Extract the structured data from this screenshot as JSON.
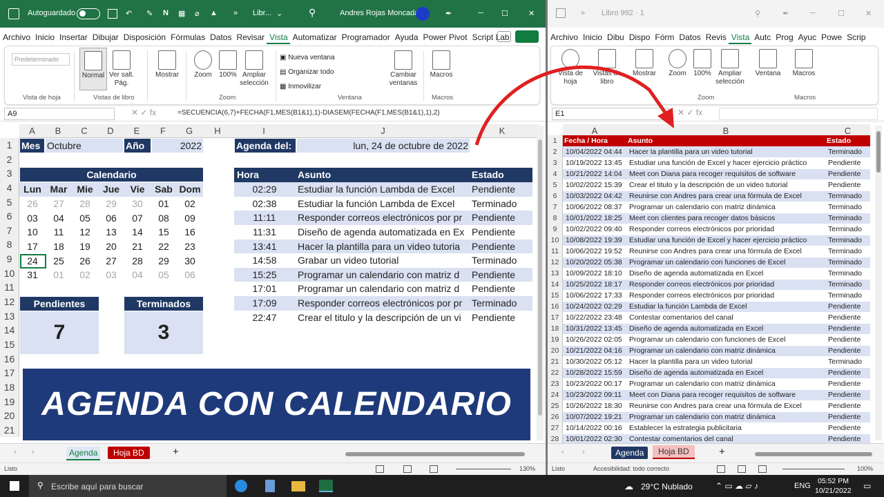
{
  "left": {
    "titlebar": {
      "autosave": "Autoguardado",
      "doc": "Libr...",
      "user": "Andres Rojas Moncada",
      "avatar": "excel"
    },
    "tabs": [
      "Archivo",
      "Inicio",
      "Insertar",
      "Dibujar",
      "Disposición",
      "Fórmulas",
      "Datos",
      "Revisar",
      "Vista",
      "Automatizar",
      "Programador",
      "Ayuda",
      "Power Pivot",
      "Script Lab"
    ],
    "active_tab": "Vista",
    "ribbon": {
      "default_view": "Predeterminado",
      "normal": "Normal",
      "page_break": "Ver salt. Pág.",
      "show": "Mostrar",
      "zoom": "Zoom",
      "zoom100": "100%",
      "zoom_sel": "Ampliar selección",
      "new_window": "Nueva ventana",
      "arrange": "Organizar todo",
      "freeze": "Inmovilizar",
      "switch": "Cambiar ventanas",
      "macros": "Macros",
      "groups": {
        "sheet_view": "Vista de hoja",
        "book_views": "Vistas de libro",
        "zoom": "Zoom",
        "window": "Ventana",
        "macros": "Macros"
      }
    },
    "namebox": "A9",
    "formula": "=SECUENCIA(6,7)+FECHA(F1,MES(B1&1),1)-DIASEM(FECHA(F1,MES(B1&1),1),2)",
    "columns": [
      "A",
      "B",
      "C",
      "D",
      "E",
      "F",
      "G",
      "H",
      "I",
      "J",
      "K"
    ],
    "rows": [
      "1",
      "2",
      "3",
      "4",
      "5",
      "6",
      "7",
      "8",
      "9",
      "10",
      "11",
      "12",
      "13",
      "14",
      "15",
      "16",
      "17",
      "18",
      "19",
      "20",
      "21"
    ],
    "mes_label": "Mes",
    "mes_value": "Octubre",
    "anio_label": "Año",
    "anio_value": "2022",
    "calendar_title": "Calendario",
    "weekdays": [
      "Lun",
      "Mar",
      "Mie",
      "Jue",
      "Vie",
      "Sab",
      "Dom"
    ],
    "weeks": [
      [
        "26",
        "27",
        "28",
        "29",
        "30",
        "01",
        "02"
      ],
      [
        "03",
        "04",
        "05",
        "06",
        "07",
        "08",
        "09"
      ],
      [
        "10",
        "11",
        "12",
        "13",
        "14",
        "15",
        "16"
      ],
      [
        "17",
        "18",
        "19",
        "20",
        "21",
        "22",
        "23"
      ],
      [
        "24",
        "25",
        "26",
        "27",
        "28",
        "29",
        "30"
      ],
      [
        "31",
        "01",
        "02",
        "03",
        "04",
        "05",
        "06"
      ]
    ],
    "pend_label": "Pendientes",
    "pend_value": "7",
    "term_label": "Terminados",
    "term_value": "3",
    "agenda_label": "Agenda del:",
    "agenda_date": "lun, 24 de octubre de 2022",
    "agenda_headers": [
      "Hora",
      "Asunto",
      "Estado"
    ],
    "agenda": [
      [
        "02:29",
        "Estudiar la función Lambda de Excel",
        "Pendiente"
      ],
      [
        "02:38",
        "Estudiar la función Lambda de Excel",
        "Terminado"
      ],
      [
        "11:11",
        "Responder correos electrónicos por pr",
        "Pendiente"
      ],
      [
        "11:31",
        "Diseño de agenda automatizada en Ex",
        "Pendiente"
      ],
      [
        "13:41",
        "Hacer la plantilla para un video tutoria",
        "Pendiente"
      ],
      [
        "14:58",
        "Grabar un video tutorial",
        "Terminado"
      ],
      [
        "15:25",
        "Programar un calendario con matriz d",
        "Pendiente"
      ],
      [
        "17:01",
        "Programar un calendario con matriz d",
        "Pendiente"
      ],
      [
        "17:09",
        "Responder correos electrónicos por pr",
        "Terminado"
      ],
      [
        "22:47",
        "Crear el titulo y la descripción de un vi",
        "Pendiente"
      ]
    ],
    "banner": "AGENDA CON CALENDARIO",
    "sheets": [
      "Agenda",
      "Hoja BD"
    ],
    "status": "Listo",
    "zoom": "130%"
  },
  "right": {
    "titlebar": {
      "doc": "Libro 992 · 1"
    },
    "tabs": [
      "Archivo",
      "Inicio",
      "Dibu",
      "Dispo",
      "Fórm",
      "Datos",
      "Revis",
      "Vista",
      "Autc",
      "Prog",
      "Ayuc",
      "Powe",
      "Scrip"
    ],
    "active_tab": "Vista",
    "ribbon": {
      "sheet_view": "Vista de hoja",
      "book_views": "Vistas de libro",
      "show": "Mostrar",
      "zoom": "Zoom",
      "zoom100": "100%",
      "zoom_sel": "Ampliar selección",
      "window": "Ventana",
      "macros": "Macros",
      "groups": {
        "zoom": "Zoom",
        "macros": "Macros"
      }
    },
    "namebox": "E1",
    "columns": [
      "A",
      "B",
      "C"
    ],
    "headers": [
      "Fecha / Hora",
      "Asunto",
      "Estado"
    ],
    "rows": [
      [
        "10/04/2022 04:44",
        "Hacer la plantilla para un video tutorial",
        "Terminado"
      ],
      [
        "10/19/2022 13:45",
        "Estudiar una función de Excel y hacer ejercicio práctico",
        "Pendiente"
      ],
      [
        "10/21/2022 14:04",
        "Meet con Diana para recoger requisitos de software",
        "Pendiente"
      ],
      [
        "10/02/2022 15:39",
        "Crear el titulo y la descripción de un video tutorial",
        "Pendiente"
      ],
      [
        "10/03/2022 04:42",
        "Reunirse con Andres para crear una fórmula de Excel",
        "Terminado"
      ],
      [
        "10/06/2022 08:37",
        "Programar un calendario con matriz dinámica",
        "Terminado"
      ],
      [
        "10/01/2022 18:25",
        "Meet con clientes para recoger datos básicos",
        "Terminado"
      ],
      [
        "10/02/2022 09:40",
        "Responder correos electrónicos por prioridad",
        "Terminado"
      ],
      [
        "10/08/2022 19:39",
        "Estudiar una función de Excel y hacer ejercicio práctico",
        "Terminado"
      ],
      [
        "10/06/2022 19:52",
        "Reunirse con Andres para crear una fórmula de Excel",
        "Terminado"
      ],
      [
        "10/20/2022 05:38",
        "Programar un calendario con funciones de Excel",
        "Terminado"
      ],
      [
        "10/09/2022 18:10",
        "Diseño de agenda automatizada en Excel",
        "Terminado"
      ],
      [
        "10/25/2022 18:17",
        "Responder correos electrónicos por prioridad",
        "Terminado"
      ],
      [
        "10/06/2022 17:33",
        "Responder correos electrónicos por prioridad",
        "Terminado"
      ],
      [
        "10/24/2022 02:29",
        "Estudiar la función Lambda de Excel",
        "Pendiente"
      ],
      [
        "10/22/2022 23:48",
        "Contestar comentarios del canal",
        "Pendiente"
      ],
      [
        "10/31/2022 13:45",
        "Diseño de agenda automatizada en Excel",
        "Pendiente"
      ],
      [
        "10/26/2022 02:05",
        "Programar un calendario con funciones de Excel",
        "Pendiente"
      ],
      [
        "10/21/2022 04:16",
        "Programar un calendario con matriz dinámica",
        "Pendiente"
      ],
      [
        "10/30/2022 05:12",
        "Hacer la plantilla para un video tutorial",
        "Terminado"
      ],
      [
        "10/28/2022 15:59",
        "Diseño de agenda automatizada en Excel",
        "Pendiente"
      ],
      [
        "10/23/2022 00:17",
        "Programar un calendario con matriz dinámica",
        "Pendiente"
      ],
      [
        "10/23/2022 09:11",
        "Meet con Diana para recoger requisitos de software",
        "Pendiente"
      ],
      [
        "10/26/2022 18:30",
        "Reunirse con Andres para crear una fórmula de Excel",
        "Pendiente"
      ],
      [
        "10/07/2022 19:21",
        "Programar un calendario con matriz dinámica",
        "Pendiente"
      ],
      [
        "10/14/2022 00:16",
        "Establecer la estrategia publicitaria",
        "Pendiente"
      ],
      [
        "10/01/2022 02:30",
        "Contestar comentarios del canal",
        "Pendiente"
      ]
    ],
    "sheets": [
      "Agenda",
      "Hoja BD"
    ],
    "status": "Listo",
    "accessibility": "Accesibilidad: todo correcto",
    "zoom": "100%"
  },
  "taskbar": {
    "search": "Escribe aquí para buscar",
    "weather": "29°C Nublado",
    "lang": "ENG",
    "time": "05:52 PM",
    "date": "10/21/2022"
  },
  "colors": {
    "excel_green": "#217346",
    "header_dark": "#203864",
    "light_blue": "#d9e1f2",
    "db_header_red": "#c00000",
    "banner": "#1f3a7a",
    "arrow": "#e02020"
  }
}
